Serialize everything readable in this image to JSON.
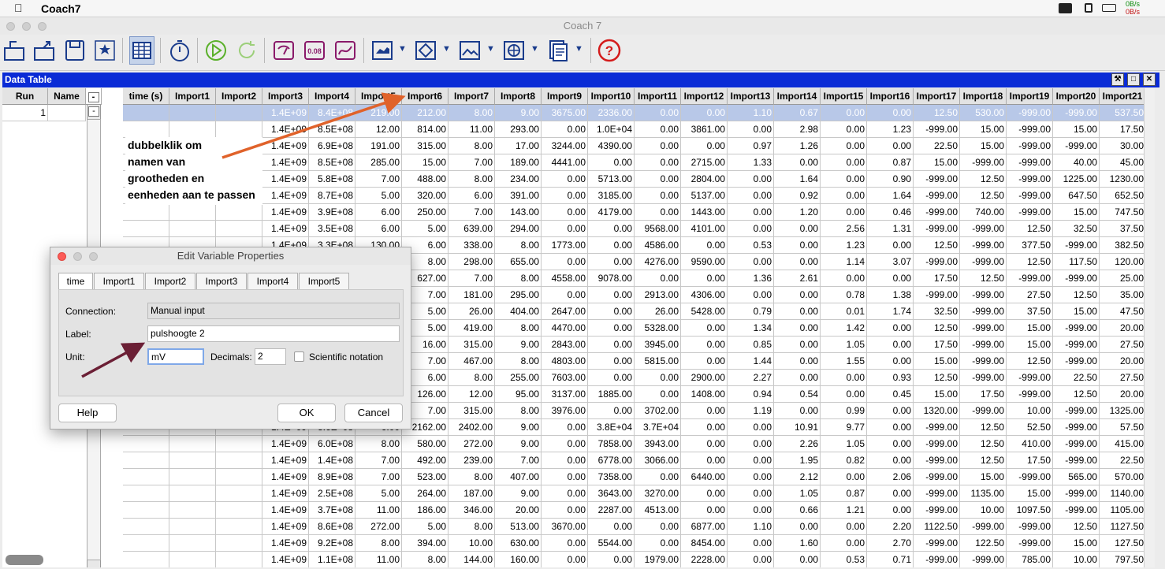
{
  "menubar": {
    "app_name": "Coach7",
    "net_up": "0B/s",
    "net_down": "0B/s"
  },
  "window": {
    "title": "Coach 7"
  },
  "toolbar": {
    "icons": [
      "new-activity-icon",
      "open-activity-icon",
      "save-icon",
      "settings-icon",
      "data-table-icon",
      "stopwatch-icon",
      "start-icon",
      "refresh-icon",
      "sensor-icon",
      "value-display-icon",
      "graph-icon",
      "animation-icon",
      "diagram-icon",
      "image-icon",
      "web-icon",
      "text-icon",
      "help-icon"
    ],
    "value_display_text": "0.08"
  },
  "panel": {
    "title": "Data Table"
  },
  "runs": {
    "headers": [
      "Run",
      "Name"
    ],
    "collapse_label": "-",
    "rows": [
      {
        "run": "1",
        "name": "",
        "toggle": "-"
      }
    ]
  },
  "table": {
    "headers": [
      "time (s)",
      "Import1",
      "Import2",
      "Import3",
      "Import4",
      "Import5",
      "Import6",
      "Import7",
      "Import8",
      "Import9",
      "Import10",
      "Import11",
      "Import12",
      "Import13",
      "Import14",
      "Import15",
      "Import16",
      "Import17",
      "Import18",
      "Import19",
      "Import20",
      "Import21"
    ],
    "rows": [
      [
        "",
        "",
        "",
        "1.4E+09",
        "8.4E+08",
        "219.00",
        "212.00",
        "8.00",
        "9.00",
        "3675.00",
        "2336.00",
        "0.00",
        "0.00",
        "1.10",
        "0.67",
        "0.00",
        "0.00",
        "12.50",
        "530.00",
        "-999.00",
        "-999.00",
        "537.50"
      ],
      [
        "",
        "",
        "",
        "1.4E+09",
        "8.5E+08",
        "12.00",
        "814.00",
        "11.00",
        "293.00",
        "0.00",
        "1.0E+04",
        "0.00",
        "3861.00",
        "0.00",
        "2.98",
        "0.00",
        "1.23",
        "-999.00",
        "15.00",
        "-999.00",
        "15.00",
        "17.50"
      ],
      [
        "",
        "",
        "",
        "1.4E+09",
        "6.9E+08",
        "191.00",
        "315.00",
        "8.00",
        "17.00",
        "3244.00",
        "4390.00",
        "0.00",
        "0.00",
        "0.97",
        "1.26",
        "0.00",
        "0.00",
        "22.50",
        "15.00",
        "-999.00",
        "-999.00",
        "30.00"
      ],
      [
        "",
        "",
        "",
        "1.4E+09",
        "8.5E+08",
        "285.00",
        "15.00",
        "7.00",
        "189.00",
        "4441.00",
        "0.00",
        "0.00",
        "2715.00",
        "1.33",
        "0.00",
        "0.00",
        "0.87",
        "15.00",
        "-999.00",
        "-999.00",
        "40.00",
        "45.00"
      ],
      [
        "",
        "",
        "",
        "1.4E+09",
        "5.8E+08",
        "7.00",
        "488.00",
        "8.00",
        "234.00",
        "0.00",
        "5713.00",
        "0.00",
        "2804.00",
        "0.00",
        "1.64",
        "0.00",
        "0.90",
        "-999.00",
        "12.50",
        "-999.00",
        "1225.00",
        "1230.00"
      ],
      [
        "",
        "",
        "",
        "1.4E+09",
        "8.7E+08",
        "5.00",
        "320.00",
        "6.00",
        "391.00",
        "0.00",
        "3185.00",
        "0.00",
        "5137.00",
        "0.00",
        "0.92",
        "0.00",
        "1.64",
        "-999.00",
        "12.50",
        "-999.00",
        "647.50",
        "652.50"
      ],
      [
        "",
        "",
        "",
        "1.4E+09",
        "3.9E+08",
        "6.00",
        "250.00",
        "7.00",
        "143.00",
        "0.00",
        "4179.00",
        "0.00",
        "1443.00",
        "0.00",
        "1.20",
        "0.00",
        "0.46",
        "-999.00",
        "740.00",
        "-999.00",
        "15.00",
        "747.50"
      ],
      [
        "",
        "",
        "",
        "1.4E+09",
        "3.5E+08",
        "6.00",
        "5.00",
        "639.00",
        "294.00",
        "0.00",
        "0.00",
        "9568.00",
        "4101.00",
        "0.00",
        "0.00",
        "2.56",
        "1.31",
        "-999.00",
        "-999.00",
        "12.50",
        "32.50",
        "37.50"
      ],
      [
        "",
        "",
        "",
        "1.4E+09",
        "3.3E+08",
        "130.00",
        "6.00",
        "338.00",
        "8.00",
        "1773.00",
        "0.00",
        "4586.00",
        "0.00",
        "0.53",
        "0.00",
        "1.23",
        "0.00",
        "12.50",
        "-999.00",
        "377.50",
        "-999.00",
        "382.50"
      ],
      [
        "",
        "",
        "",
        "",
        "",
        "",
        "8.00",
        "298.00",
        "655.00",
        "0.00",
        "0.00",
        "4276.00",
        "9590.00",
        "0.00",
        "0.00",
        "1.14",
        "3.07",
        "-999.00",
        "-999.00",
        "12.50",
        "117.50",
        "120.00"
      ],
      [
        "",
        "",
        "",
        "",
        "",
        "",
        "627.00",
        "7.00",
        "8.00",
        "4558.00",
        "9078.00",
        "0.00",
        "0.00",
        "1.36",
        "2.61",
        "0.00",
        "0.00",
        "17.50",
        "12.50",
        "-999.00",
        "-999.00",
        "25.00"
      ],
      [
        "",
        "",
        "",
        "",
        "",
        "",
        "7.00",
        "181.00",
        "295.00",
        "0.00",
        "0.00",
        "2913.00",
        "4306.00",
        "0.00",
        "0.00",
        "0.78",
        "1.38",
        "-999.00",
        "-999.00",
        "27.50",
        "12.50",
        "35.00"
      ],
      [
        "",
        "",
        "",
        "",
        "",
        "",
        "5.00",
        "26.00",
        "404.00",
        "2647.00",
        "0.00",
        "26.00",
        "5428.00",
        "0.79",
        "0.00",
        "0.01",
        "1.74",
        "32.50",
        "-999.00",
        "37.50",
        "15.00",
        "47.50"
      ],
      [
        "",
        "",
        "",
        "",
        "",
        "",
        "5.00",
        "419.00",
        "8.00",
        "4470.00",
        "0.00",
        "5328.00",
        "0.00",
        "1.34",
        "0.00",
        "1.42",
        "0.00",
        "12.50",
        "-999.00",
        "15.00",
        "-999.00",
        "20.00"
      ],
      [
        "",
        "",
        "",
        "",
        "",
        "",
        "16.00",
        "315.00",
        "9.00",
        "2843.00",
        "0.00",
        "3945.00",
        "0.00",
        "0.85",
        "0.00",
        "1.05",
        "0.00",
        "17.50",
        "-999.00",
        "15.00",
        "-999.00",
        "27.50"
      ],
      [
        "",
        "",
        "",
        "",
        "",
        "",
        "7.00",
        "467.00",
        "8.00",
        "4803.00",
        "0.00",
        "5815.00",
        "0.00",
        "1.44",
        "0.00",
        "1.55",
        "0.00",
        "15.00",
        "-999.00",
        "12.50",
        "-999.00",
        "20.00"
      ],
      [
        "",
        "",
        "",
        "",
        "",
        "",
        "6.00",
        "8.00",
        "255.00",
        "7603.00",
        "0.00",
        "0.00",
        "2900.00",
        "2.27",
        "0.00",
        "0.00",
        "0.93",
        "12.50",
        "-999.00",
        "-999.00",
        "22.50",
        "27.50"
      ],
      [
        "",
        "",
        "",
        "",
        "",
        "",
        "126.00",
        "12.00",
        "95.00",
        "3137.00",
        "1885.00",
        "0.00",
        "1408.00",
        "0.94",
        "0.54",
        "0.00",
        "0.45",
        "15.00",
        "17.50",
        "-999.00",
        "12.50",
        "20.00"
      ],
      [
        "",
        "",
        "",
        "",
        "",
        "",
        "7.00",
        "315.00",
        "8.00",
        "3976.00",
        "0.00",
        "3702.00",
        "0.00",
        "1.19",
        "0.00",
        "0.99",
        "0.00",
        "1320.00",
        "-999.00",
        "10.00",
        "-999.00",
        "1325.00"
      ],
      [
        "",
        "",
        "",
        "1.4E+09",
        "3.6E+08",
        "6.00",
        "2162.00",
        "2402.00",
        "9.00",
        "0.00",
        "3.8E+04",
        "3.7E+04",
        "0.00",
        "0.00",
        "10.91",
        "9.77",
        "0.00",
        "-999.00",
        "12.50",
        "52.50",
        "-999.00",
        "57.50"
      ],
      [
        "",
        "",
        "",
        "1.4E+09",
        "6.0E+08",
        "8.00",
        "580.00",
        "272.00",
        "9.00",
        "0.00",
        "7858.00",
        "3943.00",
        "0.00",
        "0.00",
        "2.26",
        "1.05",
        "0.00",
        "-999.00",
        "12.50",
        "410.00",
        "-999.00",
        "415.00"
      ],
      [
        "",
        "",
        "",
        "1.4E+09",
        "1.4E+08",
        "7.00",
        "492.00",
        "239.00",
        "7.00",
        "0.00",
        "6778.00",
        "3066.00",
        "0.00",
        "0.00",
        "1.95",
        "0.82",
        "0.00",
        "-999.00",
        "12.50",
        "17.50",
        "-999.00",
        "22.50"
      ],
      [
        "",
        "",
        "",
        "1.4E+09",
        "8.9E+08",
        "7.00",
        "523.00",
        "8.00",
        "407.00",
        "0.00",
        "7358.00",
        "0.00",
        "6440.00",
        "0.00",
        "2.12",
        "0.00",
        "2.06",
        "-999.00",
        "15.00",
        "-999.00",
        "565.00",
        "570.00"
      ],
      [
        "",
        "",
        "",
        "1.4E+09",
        "2.5E+08",
        "5.00",
        "264.00",
        "187.00",
        "9.00",
        "0.00",
        "3643.00",
        "3270.00",
        "0.00",
        "0.00",
        "1.05",
        "0.87",
        "0.00",
        "-999.00",
        "1135.00",
        "15.00",
        "-999.00",
        "1140.00"
      ],
      [
        "",
        "",
        "",
        "1.4E+09",
        "3.7E+08",
        "11.00",
        "186.00",
        "346.00",
        "20.00",
        "0.00",
        "2287.00",
        "4513.00",
        "0.00",
        "0.00",
        "0.66",
        "1.21",
        "0.00",
        "-999.00",
        "10.00",
        "1097.50",
        "-999.00",
        "1105.00"
      ],
      [
        "",
        "",
        "",
        "1.4E+09",
        "8.6E+08",
        "272.00",
        "5.00",
        "8.00",
        "513.00",
        "3670.00",
        "0.00",
        "0.00",
        "6877.00",
        "1.10",
        "0.00",
        "0.00",
        "2.20",
        "1122.50",
        "-999.00",
        "-999.00",
        "12.50",
        "1127.50"
      ],
      [
        "",
        "",
        "",
        "1.4E+09",
        "9.2E+08",
        "8.00",
        "394.00",
        "10.00",
        "630.00",
        "0.00",
        "5544.00",
        "0.00",
        "8454.00",
        "0.00",
        "1.60",
        "0.00",
        "2.70",
        "-999.00",
        "122.50",
        "-999.00",
        "15.00",
        "127.50"
      ],
      [
        "",
        "",
        "",
        "1.4E+09",
        "1.1E+08",
        "11.00",
        "8.00",
        "144.00",
        "160.00",
        "0.00",
        "0.00",
        "1979.00",
        "2228.00",
        "0.00",
        "0.00",
        "0.53",
        "0.71",
        "-999.00",
        "-999.00",
        "785.00",
        "10.00",
        "797.50"
      ]
    ]
  },
  "annotation": {
    "lines": [
      "dubbelklik om",
      "namen van",
      "grootheden en",
      "eenheden aan te passen"
    ]
  },
  "dialog": {
    "title": "Edit Variable Properties",
    "tabs": [
      "time",
      "Import1",
      "Import2",
      "Import3",
      "Import4",
      "Import5"
    ],
    "connection_label": "Connection:",
    "connection_value": "Manual input",
    "label_label": "Label:",
    "label_value": "pulshoogte 2",
    "unit_label": "Unit:",
    "unit_value": "mV",
    "decimals_label": "Decimals:",
    "decimals_value": "2",
    "scientific_label": "Scientific notation",
    "help_button": "Help",
    "ok_button": "OK",
    "cancel_button": "Cancel"
  },
  "colors": {
    "panel_title": "#0a2bd6",
    "selection": "#b8c8e8",
    "arrow_orange": "#e0622a",
    "arrow_dark": "#6b1f35"
  }
}
